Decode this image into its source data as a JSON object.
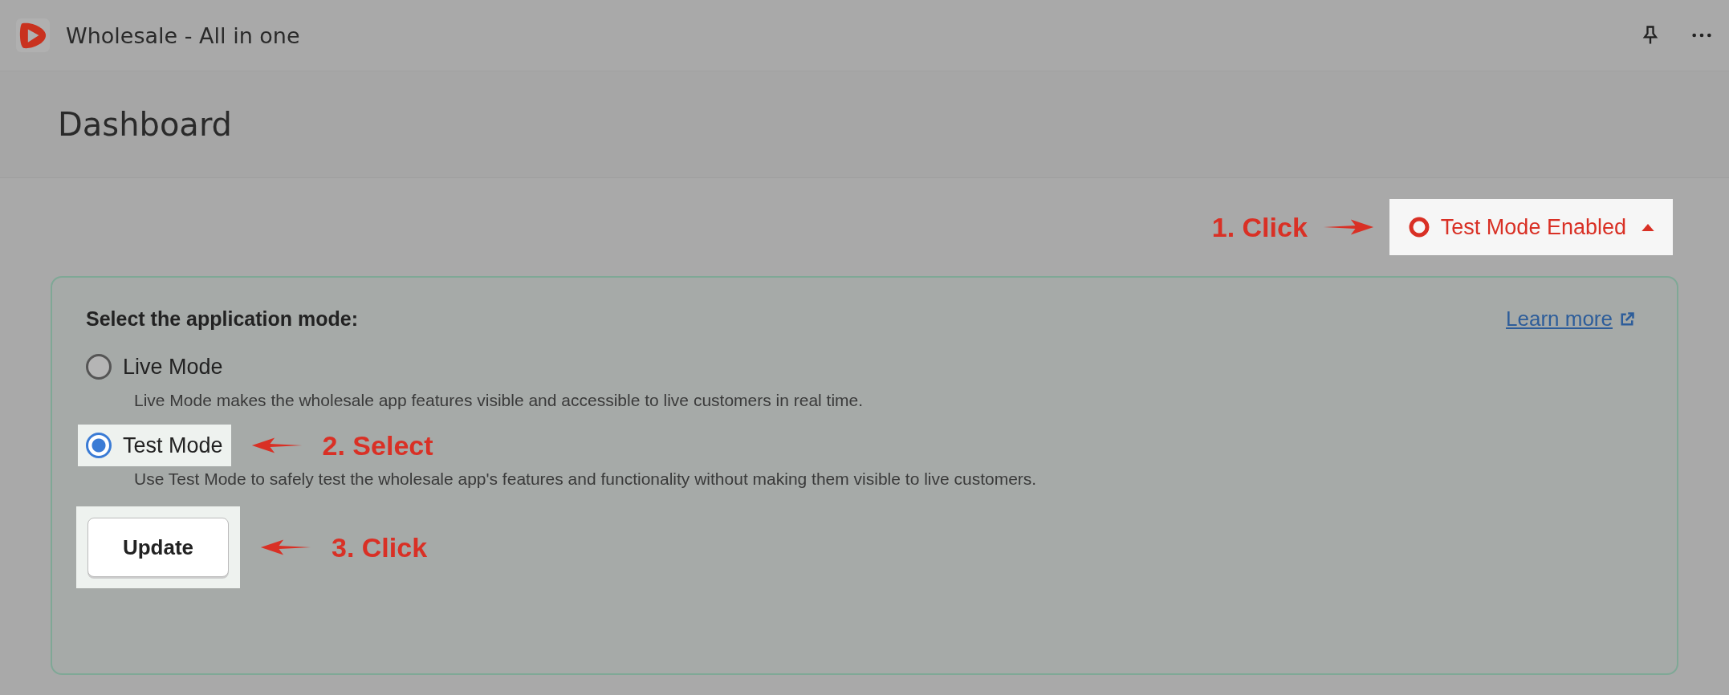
{
  "window": {
    "title": "Wholesale - All in one"
  },
  "page": {
    "title": "Dashboard"
  },
  "mode_badge": {
    "label": "Test Mode Enabled",
    "highlighted": true,
    "annotation": "1. Click"
  },
  "mode_card": {
    "heading": "Select the application mode:",
    "link": "Learn more",
    "options": [
      {
        "label": "Live Mode",
        "description": "Live Mode makes the wholesale app features visible and accessible to live customers in real time.",
        "selected": false,
        "highlighted": false
      },
      {
        "label": "Test Mode",
        "description": "Use Test Mode to safely test the wholesale app's features and functionality without making them visible to live customers.",
        "selected": true,
        "highlighted": true,
        "annotation": "2. Select"
      }
    ],
    "button": {
      "label": "Update",
      "highlighted": true,
      "annotation": "3. Click"
    }
  }
}
